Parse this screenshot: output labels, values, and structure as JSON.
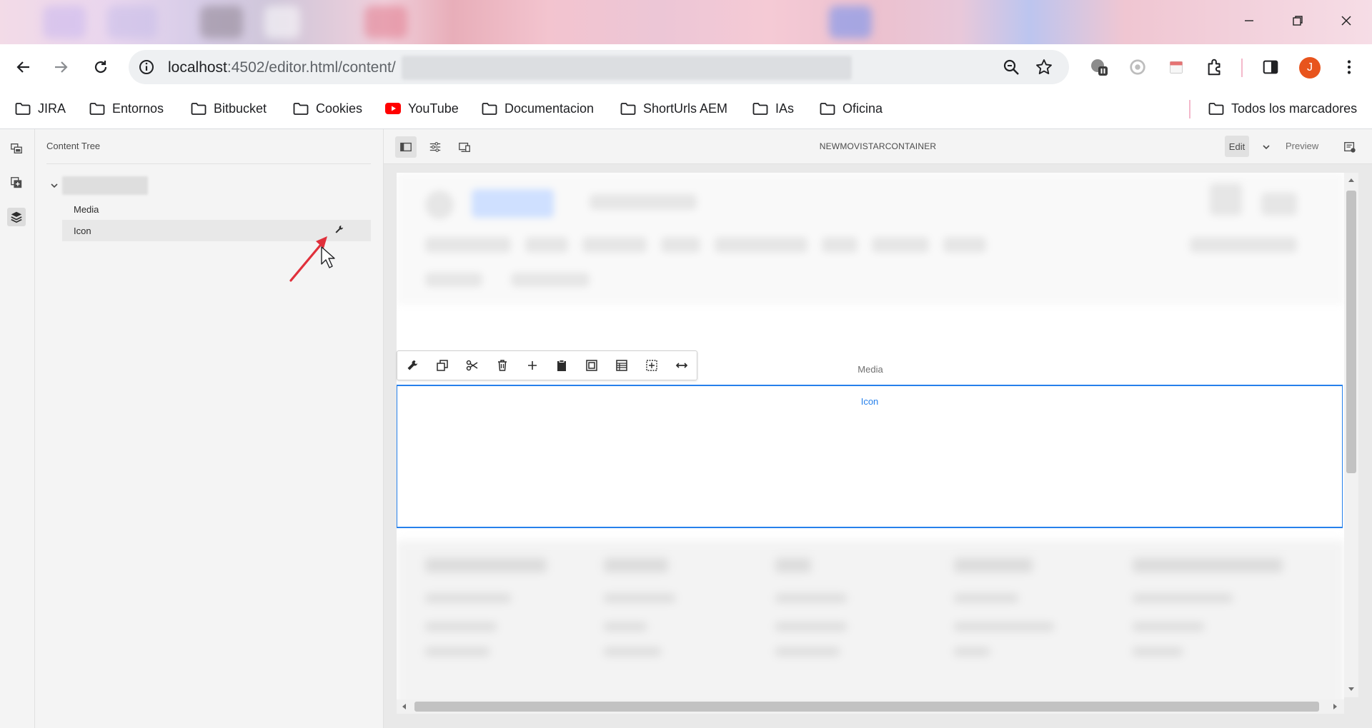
{
  "browser": {
    "url_host": "localhost",
    "url_rest": ":4502/editor.html/content/",
    "avatar_letter": "J",
    "accent_color": "#e8541d",
    "bookmarks": [
      {
        "label": "JIRA",
        "icon": "folder-icon"
      },
      {
        "label": "Entornos",
        "icon": "folder-icon"
      },
      {
        "label": "Bitbucket",
        "icon": "folder-icon"
      },
      {
        "label": "Cookies",
        "icon": "folder-icon"
      },
      {
        "label": "YouTube",
        "icon": "youtube-icon"
      },
      {
        "label": "Documentacion",
        "icon": "folder-icon"
      },
      {
        "label": "ShortUrls AEM",
        "icon": "folder-icon"
      },
      {
        "label": "IAs",
        "icon": "folder-icon"
      },
      {
        "label": "Oficina",
        "icon": "folder-icon"
      }
    ],
    "all_bookmarks_label": "Todos los marcadores"
  },
  "side_panel": {
    "title": "Content Tree",
    "tree_items": [
      {
        "label": "Media"
      },
      {
        "label": "Icon"
      }
    ]
  },
  "editor": {
    "page_title": "NEWMOVISTARCONTAINER",
    "mode_label": "Edit",
    "preview_label": "Preview",
    "selection_color": "#2680eb"
  },
  "canvas": {
    "media_label": "Media",
    "icon_label": "Icon"
  }
}
